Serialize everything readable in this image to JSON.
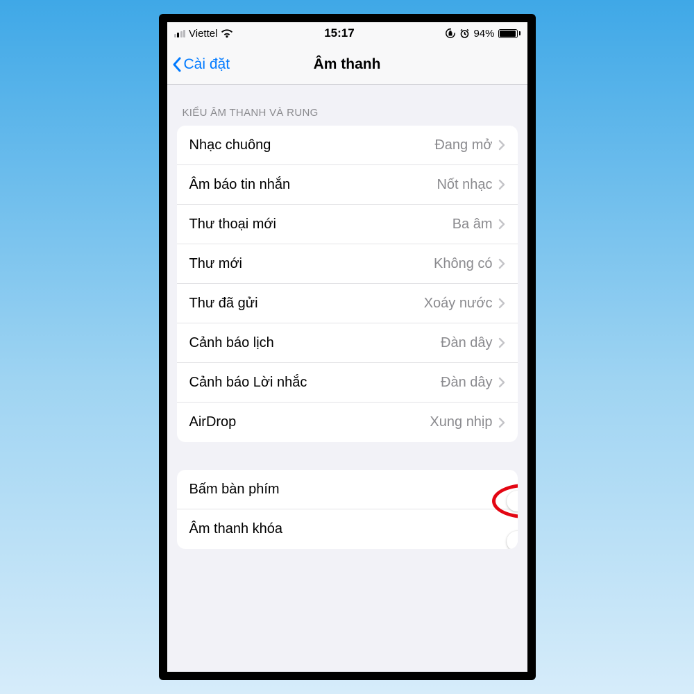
{
  "status": {
    "carrier": "Viettel",
    "time": "15:17",
    "battery_percent": "94%",
    "battery_fill_pct": 94
  },
  "nav": {
    "back_label": "Cài đặt",
    "title": "Âm thanh"
  },
  "section_header": "KIỂU ÂM THANH VÀ RUNG",
  "sounds": [
    {
      "label": "Nhạc chuông",
      "value": "Đang mở"
    },
    {
      "label": "Âm báo tin nhắn",
      "value": "Nốt nhạc"
    },
    {
      "label": "Thư thoại mới",
      "value": "Ba âm"
    },
    {
      "label": "Thư mới",
      "value": "Không có"
    },
    {
      "label": "Thư đã gửi",
      "value": "Xoáy nước"
    },
    {
      "label": "Cảnh báo lịch",
      "value": "Đàn dây"
    },
    {
      "label": "Cảnh báo Lời nhắc",
      "value": "Đàn dây"
    },
    {
      "label": "AirDrop",
      "value": "Xung nhịp"
    }
  ],
  "toggles": [
    {
      "label": "Bấm bàn phím",
      "on": false,
      "highlighted": true
    },
    {
      "label": "Âm thanh khóa",
      "on": false,
      "highlighted": false
    }
  ]
}
